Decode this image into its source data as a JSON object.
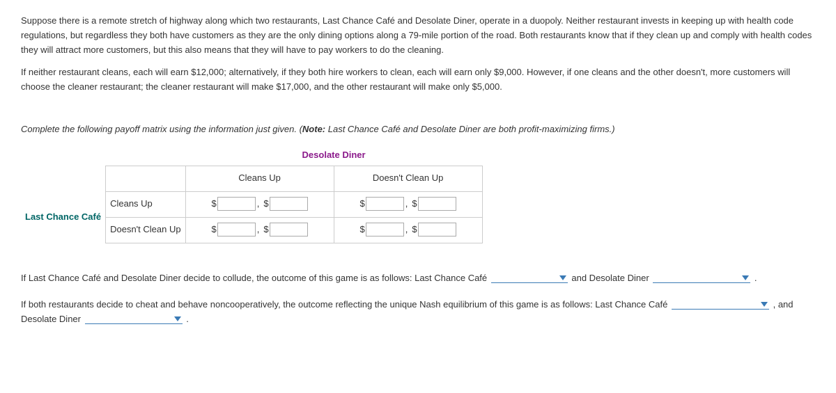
{
  "para1": "Suppose there is a remote stretch of highway along which two restaurants, Last Chance Café and Desolate Diner, operate in a duopoly. Neither restaurant invests in keeping up with health code regulations, but regardless they both have customers as they are the only dining options along a 79-mile portion of the road. Both restaurants know that if they clean up and comply with health codes they will attract more customers, but this also means that they will have to pay workers to do the cleaning.",
  "para2": "If neither restaurant cleans, each will earn $12,000; alternatively, if they both hire workers to clean, each will earn only $9,000. However, if one cleans and the other doesn't, more customers will choose the cleaner restaurant; the cleaner restaurant will make $17,000, and the other restaurant will make only $5,000.",
  "instruction_prefix": "Complete the following payoff matrix using the information just given. (",
  "note_label": "Note:",
  "instruction_note": " Last Chance Café and Desolate Diner are both profit-maximizing firms.)",
  "col_player": "Desolate Diner",
  "row_player": "Last Chance Café",
  "strategies": {
    "cleans": "Cleans Up",
    "doesnt": "Doesn't Clean Up"
  },
  "dollar": "$",
  "collude": {
    "pre": "If Last Chance Café and Desolate Diner decide to collude, the outcome of this game is as follows: Last Chance Café ",
    "and": " and Desolate Diner ",
    "period": " ."
  },
  "nash": {
    "pre": "If both restaurants decide to cheat and behave noncooperatively, the outcome reflecting the unique Nash equilibrium of this game is as follows: Last Chance Café ",
    "and": " , and Desolate Diner ",
    "period": " ."
  }
}
